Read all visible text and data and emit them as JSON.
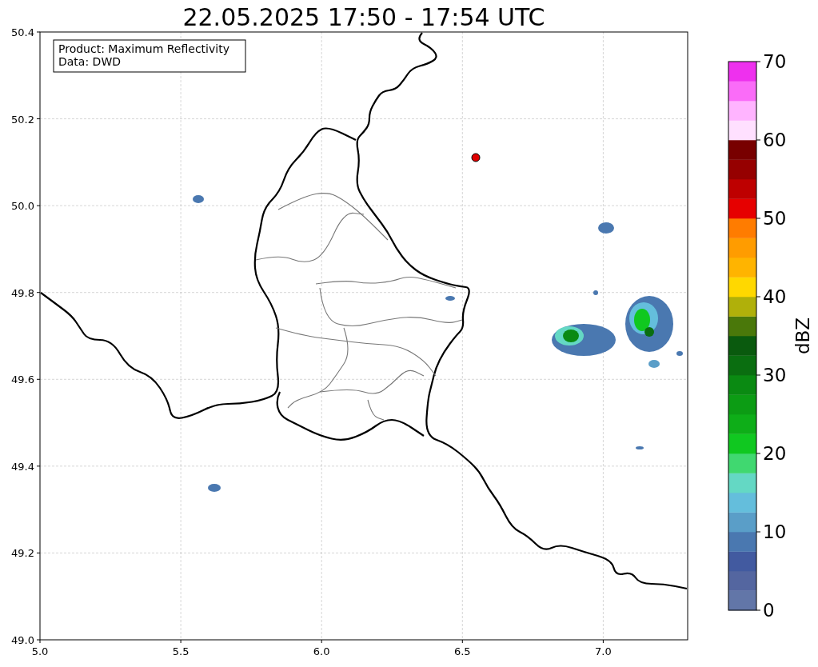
{
  "title": "22.05.2025 17:50 - 17:54 UTC",
  "info_box": {
    "lines": [
      "Product: Maximum Reflectivity",
      "Data: DWD"
    ]
  },
  "x_axis": {
    "ticks": [
      "5.0",
      "5.5",
      "6.0",
      "6.5",
      "7.0"
    ]
  },
  "y_axis": {
    "ticks": [
      "50.4",
      "50.2",
      "50.0",
      "49.8",
      "49.6",
      "49.4",
      "49.2",
      "49.0"
    ]
  },
  "colorbar": {
    "label": "dBZ",
    "ticks": [
      "70",
      "60",
      "50",
      "40",
      "30",
      "20",
      "10",
      "0"
    ],
    "segments": [
      {
        "color": "#6276a8"
      },
      {
        "color": "#5466a0"
      },
      {
        "color": "#425aa0"
      },
      {
        "color": "#4a78b0"
      },
      {
        "color": "#5a9ec8"
      },
      {
        "color": "#64bedc"
      },
      {
        "color": "#64d8c4"
      },
      {
        "color": "#40d870"
      },
      {
        "color": "#10c820"
      },
      {
        "color": "#0eae18"
      },
      {
        "color": "#0c9c14"
      },
      {
        "color": "#0a8a12"
      },
      {
        "color": "#0a6e10"
      },
      {
        "color": "#0a5a0e"
      },
      {
        "color": "#4a780a"
      },
      {
        "color": "#b0b00a"
      },
      {
        "color": "#ffd800"
      },
      {
        "color": "#ffb400"
      },
      {
        "color": "#ff9c00"
      },
      {
        "color": "#ff7c00"
      },
      {
        "color": "#e60000"
      },
      {
        "color": "#be0000"
      },
      {
        "color": "#960000"
      },
      {
        "color": "#780000"
      },
      {
        "color": "#ffe0ff"
      },
      {
        "color": "#ffb4ff"
      },
      {
        "color": "#fa6cf8"
      },
      {
        "color": "#ee30ee"
      }
    ]
  }
}
